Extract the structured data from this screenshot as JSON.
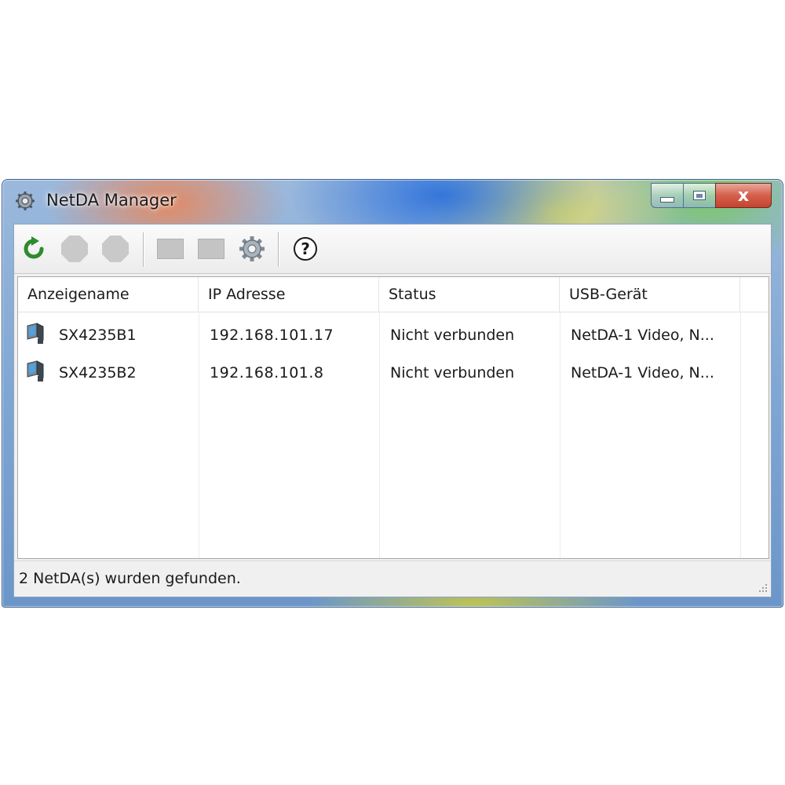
{
  "window": {
    "title": "NetDA Manager",
    "close_glyph": "x"
  },
  "toolbar": {
    "items": [
      {
        "name": "refresh-icon"
      },
      {
        "name": "stop-icon"
      },
      {
        "name": "stop-icon"
      },
      {
        "name": "screen-icon"
      },
      {
        "name": "screen-icon"
      },
      {
        "name": "gear-icon"
      },
      {
        "name": "help-icon",
        "glyph": "?"
      }
    ]
  },
  "list": {
    "columns": [
      "Anzeigename",
      "IP Adresse",
      "Status",
      "USB-Gerät"
    ],
    "rows": [
      {
        "name": "SX4235B1",
        "ip": "192.168.101.17",
        "status": "Nicht verbunden",
        "usb": "NetDA-1 Video, N..."
      },
      {
        "name": "SX4235B2",
        "ip": "192.168.101.8",
        "status": "Nicht verbunden",
        "usb": "NetDA-1 Video, N..."
      }
    ]
  },
  "statusbar": {
    "text": "2 NetDA(s) wurden gefunden."
  }
}
